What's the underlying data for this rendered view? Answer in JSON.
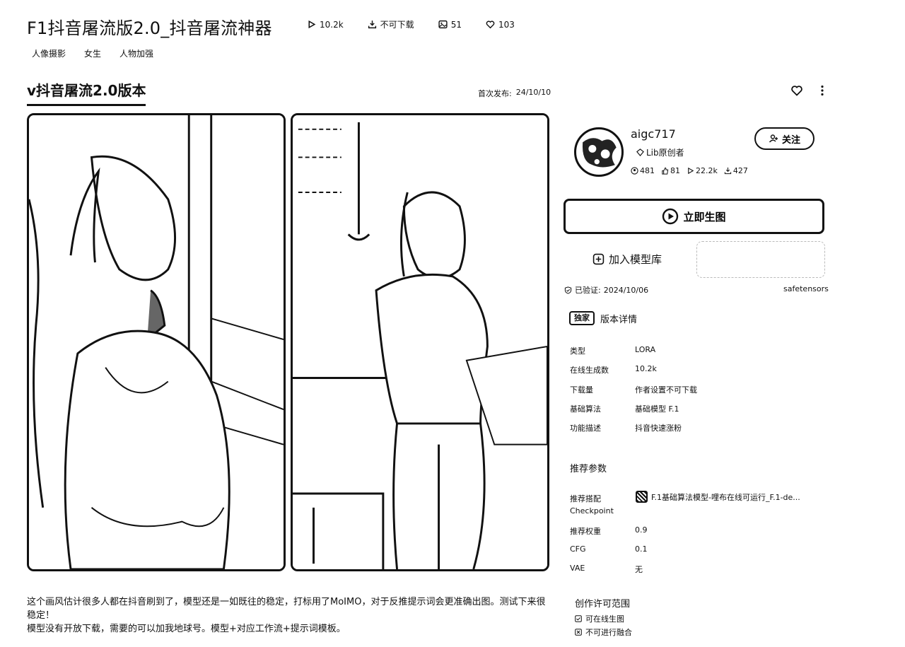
{
  "model": {
    "title": "F1抖音屠流版2.0_抖音屠流神器",
    "stats": {
      "runs": "10.2k",
      "download": "不可下载",
      "images": "51",
      "likes": "103"
    },
    "tags": [
      "人像摄影",
      "女生",
      "人物加强"
    ]
  },
  "version": {
    "tab_label": "v抖音屠流2.0版本",
    "first_release_label": "首次发布:",
    "first_release_date": "24/10/10"
  },
  "author": {
    "name": "aigc717",
    "role": "Lib原创者",
    "stats": [
      "481",
      "81",
      "22.2k",
      "427"
    ],
    "follow_label": "关注"
  },
  "actions": {
    "generate_label": "立即生图",
    "add_library_label": "加入模型库"
  },
  "verification": {
    "label": "已验证:",
    "date": "2024/10/06",
    "format": "safetensors"
  },
  "details": {
    "badge": "独家",
    "header": "版本详情",
    "rows": [
      {
        "key": "类型",
        "value": "LORA"
      },
      {
        "key": "在线生成数",
        "value": "10.2k"
      },
      {
        "key": "下载量",
        "value": "作者设置不可下载"
      },
      {
        "key": "基础算法",
        "value": "基础模型 F.1"
      },
      {
        "key": "功能描述",
        "value": "抖音快速涨粉"
      }
    ]
  },
  "recommended": {
    "header": "推荐参数",
    "checkpoint_label_line1": "推荐搭配",
    "checkpoint_label_line2": "Checkpoint",
    "checkpoint_value": "F.1基础算法模型-哩布在线可运行_F.1-de...",
    "rows": [
      {
        "key": "推荐权重",
        "value": "0.9"
      },
      {
        "key": "CFG",
        "value": "0.1"
      },
      {
        "key": "VAE",
        "value": "无"
      }
    ]
  },
  "description": {
    "line1": "这个画风估计很多人都在抖音刷到了，模型还是一如既往的稳定，打标用了MoIMO，对于反推提示词会更准确出图。测试下来很稳定！",
    "line2": "模型没有开放下载，需要的可以加我地球号。模型+对应工作流+提示词模板。"
  },
  "license": {
    "header": "创作许可范围",
    "items": [
      "可在线生图",
      "不可进行融合"
    ]
  }
}
